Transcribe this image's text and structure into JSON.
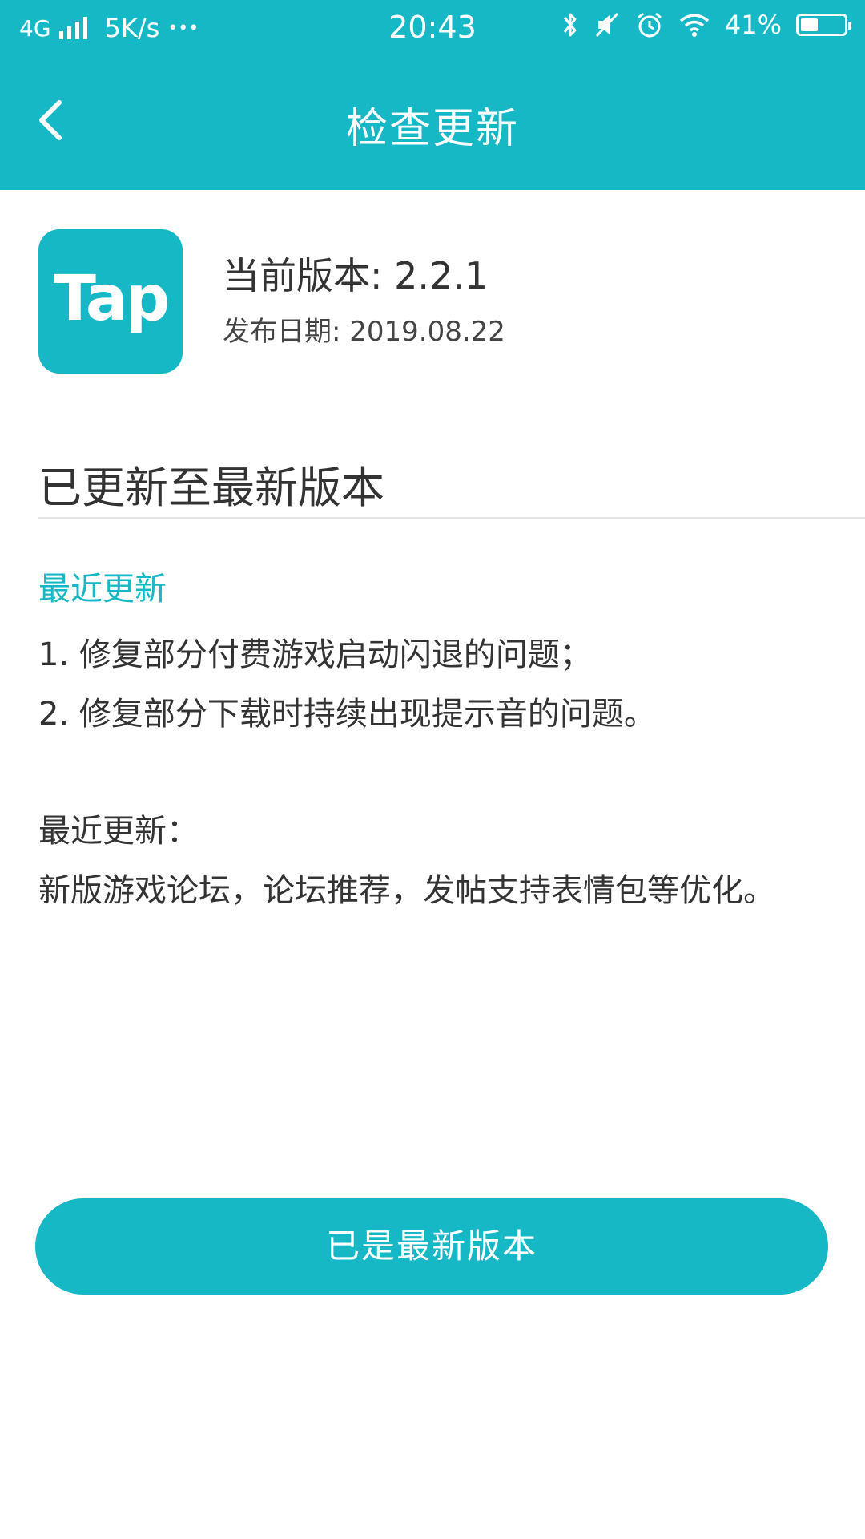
{
  "status_bar": {
    "network": "4G",
    "speed": "5K/s",
    "more": "•••",
    "time": "20:43",
    "battery_text": "41%",
    "battery_level": 0.41,
    "icons": [
      "bluetooth-icon",
      "mute-icon",
      "alarm-icon",
      "wifi-icon",
      "battery-icon"
    ]
  },
  "nav": {
    "title": "检查更新",
    "back_icon": "chevron-left-icon"
  },
  "app": {
    "icon_text": "Tap",
    "version": "当前版本: 2.2.1",
    "release_date": "发布日期: 2019.08.22"
  },
  "status_heading": "已更新至最新版本",
  "recent_update": {
    "title": "最近更新",
    "items": [
      "1. 修复部分付费游戏启动闪退的问题；",
      "2. 修复部分下载时持续出现提示音的问题。"
    ]
  },
  "previous_update": {
    "title": "最近更新：",
    "text": "新版游戏论坛，论坛推荐，发帖支持表情包等优化。"
  },
  "button": {
    "label": "已是最新版本"
  },
  "colors": {
    "accent": "#17b8c6",
    "text": "#333333",
    "divider": "#e5e5e5"
  }
}
